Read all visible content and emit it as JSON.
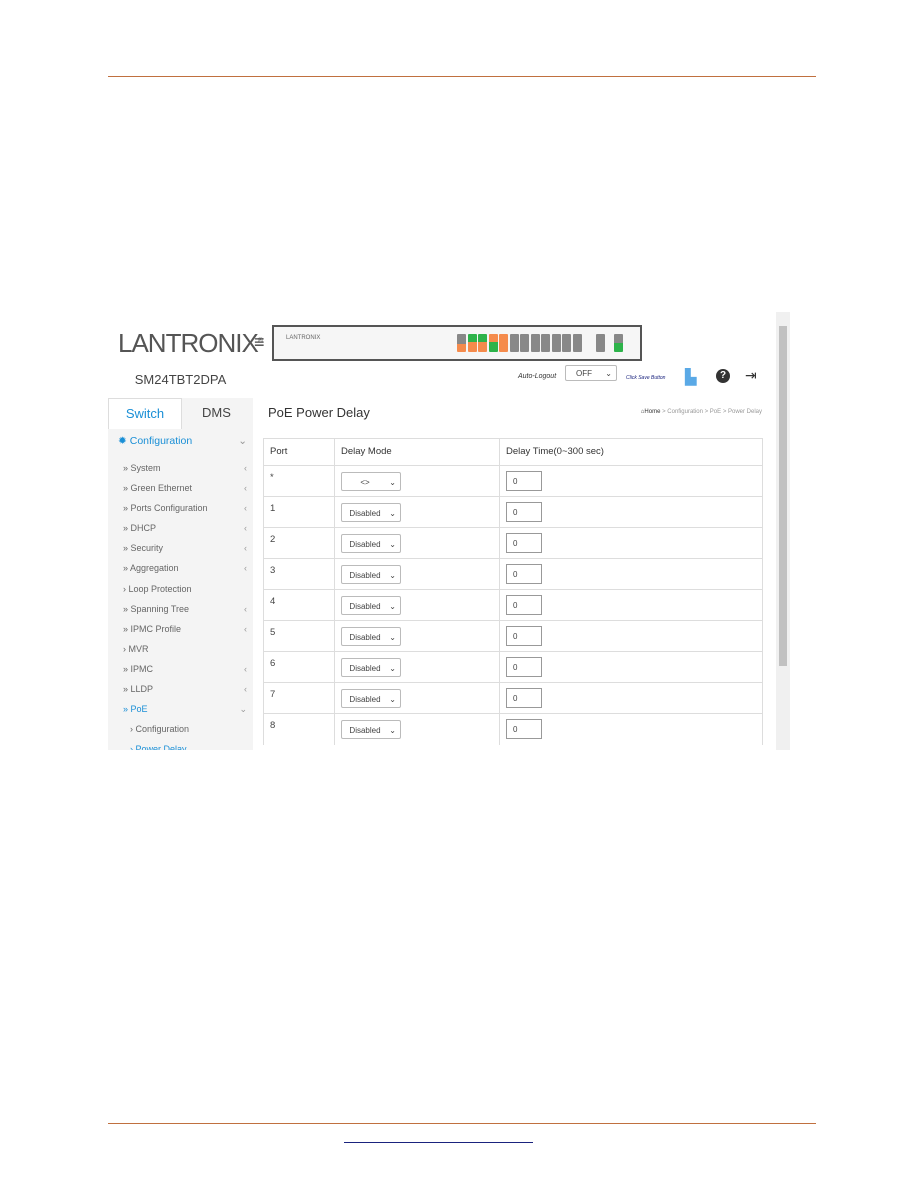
{
  "app": {
    "logo": "LANTRONIX",
    "logo_mark": "®",
    "device_label": "LANTRONIX",
    "model": "SM24TBT2DPA"
  },
  "tabs": [
    {
      "label": "Switch",
      "active": true
    },
    {
      "label": "DMS",
      "active": false
    }
  ],
  "topbar": {
    "auto_logout_label": "Auto-Logout",
    "auto_logout_value": "OFF",
    "save_hint": "Click Save Button"
  },
  "menu": {
    "head": "Configuration",
    "items": [
      {
        "label": "» System",
        "chev": "‹"
      },
      {
        "label": "» Green Ethernet",
        "chev": "‹"
      },
      {
        "label": "» Ports Configuration",
        "chev": "‹"
      },
      {
        "label": "» DHCP",
        "chev": "‹"
      },
      {
        "label": "» Security",
        "chev": "‹"
      },
      {
        "label": "» Aggregation",
        "chev": "‹"
      },
      {
        "label": "› Loop Protection",
        "chev": ""
      },
      {
        "label": "» Spanning Tree",
        "chev": "‹"
      },
      {
        "label": "» IPMC Profile",
        "chev": "‹"
      },
      {
        "label": "› MVR",
        "chev": ""
      },
      {
        "label": "» IPMC",
        "chev": "‹"
      },
      {
        "label": "» LLDP",
        "chev": "‹"
      },
      {
        "label": "» PoE",
        "chev": "⌄"
      }
    ],
    "sub": [
      {
        "label": "› Configuration"
      },
      {
        "label": "› Power Delay"
      }
    ]
  },
  "main": {
    "title": "PoE Power Delay",
    "breadcrumb": {
      "home": "Home",
      "path": "> Configuration > PoE > Power Delay"
    },
    "columns": [
      "Port",
      "Delay Mode",
      "Delay Time(0~300 sec)"
    ],
    "rows": [
      {
        "port": "*",
        "mode": "<>",
        "time": "0"
      },
      {
        "port": "1",
        "mode": "Disabled",
        "time": "0"
      },
      {
        "port": "2",
        "mode": "Disabled",
        "time": "0"
      },
      {
        "port": "3",
        "mode": "Disabled",
        "time": "0"
      },
      {
        "port": "4",
        "mode": "Disabled",
        "time": "0"
      },
      {
        "port": "5",
        "mode": "Disabled",
        "time": "0"
      },
      {
        "port": "6",
        "mode": "Disabled",
        "time": "0"
      },
      {
        "port": "7",
        "mode": "Disabled",
        "time": "0"
      },
      {
        "port": "8",
        "mode": "Disabled",
        "time": "0"
      }
    ]
  },
  "colors": {
    "accent": "#1a8fd6",
    "brand_orange": "#f47b20",
    "rule": "#c0703f",
    "port_green": "#2db34a",
    "port_orange": "#f58b4c"
  }
}
